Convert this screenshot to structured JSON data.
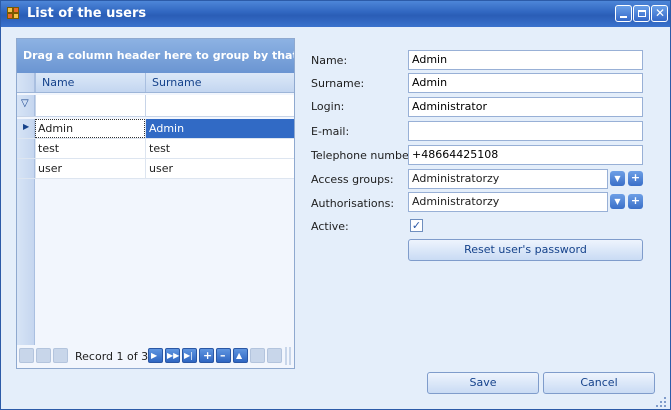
{
  "window": {
    "title": "List of the users",
    "accent": "#2f65bf"
  },
  "grid": {
    "group_panel_text": "Drag a column header here to group by that co",
    "columns": [
      "Name",
      "Surname"
    ],
    "rows": [
      {
        "name": "Admin",
        "surname": "Admin"
      },
      {
        "name": "test",
        "surname": "test"
      },
      {
        "name": "user",
        "surname": "user"
      }
    ],
    "navigator": {
      "record_text": "Record 1 of 3"
    }
  },
  "form": {
    "name_label": "Name:",
    "name_value": "Admin",
    "surname_label": "Surname:",
    "surname_value": "Admin",
    "login_label": "Login:",
    "login_value": "Administrator",
    "email_label": "E-mail:",
    "email_value": "",
    "phone_label": "Telephone number:",
    "phone_value": "+48664425108",
    "access_label": "Access groups:",
    "access_value": "Administratorzy",
    "auth_label": "Authorisations:",
    "auth_value": "Administratorzy",
    "active_label": "Active:",
    "active_checked": true,
    "reset_label": "Reset user's password"
  },
  "footer": {
    "save_label": "Save",
    "cancel_label": "Cancel"
  }
}
